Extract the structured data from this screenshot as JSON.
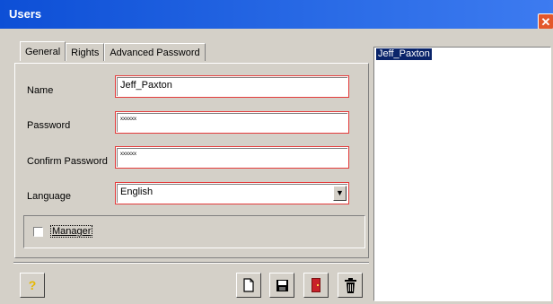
{
  "window": {
    "title": "Users",
    "close_glyph": "✕"
  },
  "tabs": [
    {
      "label": "General",
      "active": true
    },
    {
      "label": "Rights",
      "active": false
    },
    {
      "label": "Advanced Password",
      "active": false
    }
  ],
  "form": {
    "name_label": "Name",
    "name_value": "Jeff_Paxton",
    "password_label": "Password",
    "password_value": "xxxxxx",
    "confirm_label": "Confirm Password",
    "confirm_value": "xxxxxx",
    "language_label": "Language",
    "language_value": "English",
    "manager_label": "Manager",
    "manager_checked": false
  },
  "toolbar": {
    "help_icon": "?",
    "new_icon": "new-document-icon",
    "save_icon": "floppy-disk-icon",
    "exit_icon": "exit-door-icon",
    "delete_icon": "trash-icon"
  },
  "users_list": [
    {
      "name": "Jeff_Paxton",
      "selected": true
    }
  ],
  "colors": {
    "titlebar": "#0d4fd6",
    "selection": "#0a246a",
    "field_error_border": "#e43b3b",
    "window_bg": "#d4d0c8"
  }
}
